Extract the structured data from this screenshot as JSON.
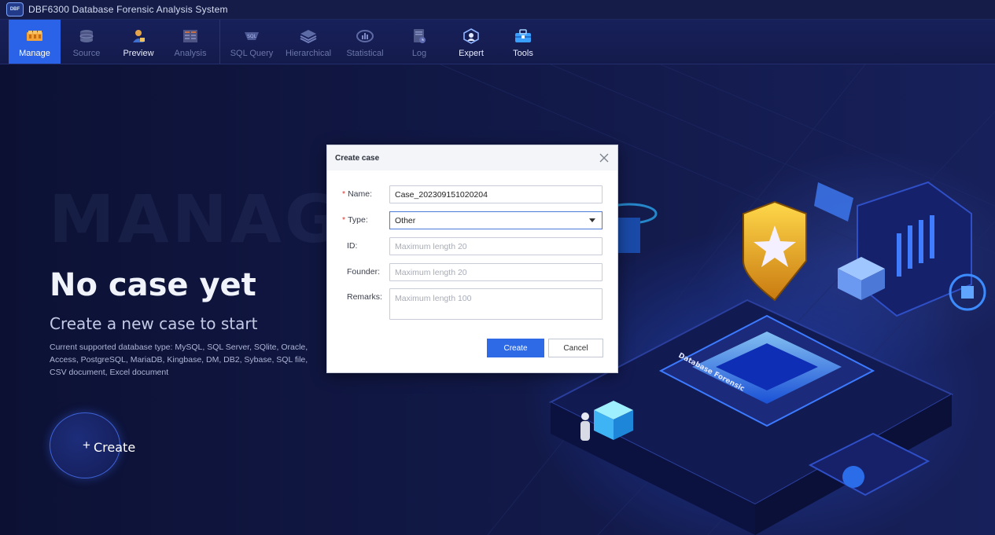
{
  "app": {
    "logo_text": "DBF",
    "title": "DBF6300 Database Forensic Analysis System"
  },
  "toolbar": {
    "items": [
      {
        "label": "Manage",
        "icon": "folders-icon",
        "state": "active"
      },
      {
        "label": "Source",
        "icon": "database-icon",
        "state": "disabled"
      },
      {
        "label": "Preview",
        "icon": "user-preview-icon",
        "state": "enabled"
      },
      {
        "label": "Analysis",
        "icon": "table-analysis-icon",
        "state": "disabled"
      },
      {
        "label": "SQL Query",
        "icon": "sql-query-icon",
        "state": "disabled"
      },
      {
        "label": "Hierarchical",
        "icon": "layers-icon",
        "state": "disabled"
      },
      {
        "label": "Statistical",
        "icon": "statistics-icon",
        "state": "disabled"
      },
      {
        "label": "Log",
        "icon": "log-icon",
        "state": "disabled"
      },
      {
        "label": "Expert",
        "icon": "expert-icon",
        "state": "enabled"
      },
      {
        "label": "Tools",
        "icon": "toolbox-icon",
        "state": "enabled"
      }
    ]
  },
  "main": {
    "watermark": "MANAGEMENT",
    "headline": "No case yet",
    "subhead": "Create a new case to start",
    "supported_types": "Current supported database type: MySQL, SQL Server, SQlite, Oracle, Access, PostgreSQL, MariaDB, Kingbase, DM, DB2, Sybase, SQL file, CSV document, Excel document",
    "create_plus": "+",
    "create_label": "Create",
    "art_label": "Database Forensic"
  },
  "dialog": {
    "title": "Create case",
    "required_mark": "*",
    "name_label": "Name:",
    "name_value": "Case_202309151020204",
    "type_label": "Type:",
    "type_value": "Other",
    "id_label": "ID:",
    "id_placeholder": "Maximum length 20",
    "founder_label": "Founder:",
    "founder_placeholder": "Maximum length 20",
    "remarks_label": "Remarks:",
    "remarks_placeholder": "Maximum length 100",
    "create_button": "Create",
    "cancel_button": "Cancel"
  },
  "colors": {
    "accent": "#2e6ae6",
    "toolbar_active": "#2a63e8",
    "background": "#0d1238",
    "required": "#e0352b"
  }
}
